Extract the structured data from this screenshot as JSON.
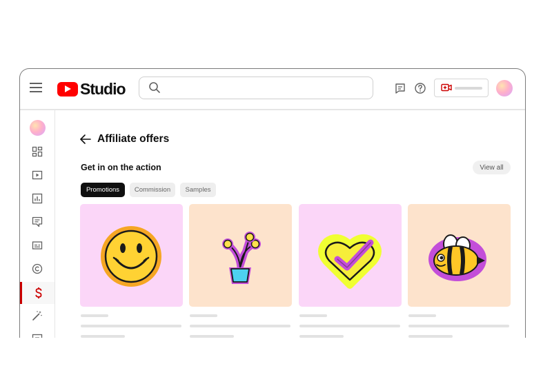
{
  "app": {
    "name": "Studio",
    "search_placeholder": ""
  },
  "page": {
    "title": "Affiliate offers",
    "section_title": "Get in on the action",
    "view_all_label": "View all"
  },
  "tabs": [
    {
      "label": "Promotions",
      "active": true
    },
    {
      "label": "Commission",
      "active": false
    },
    {
      "label": "Samples",
      "active": false
    }
  ],
  "sidebar": {
    "items": [
      {
        "icon": "dashboard-icon"
      },
      {
        "icon": "content-icon"
      },
      {
        "icon": "analytics-icon"
      },
      {
        "icon": "comments-icon"
      },
      {
        "icon": "subtitles-icon"
      },
      {
        "icon": "copyright-icon"
      },
      {
        "icon": "earn-icon",
        "active": true
      },
      {
        "icon": "customization-icon"
      }
    ]
  },
  "cards": [
    {
      "image": "smiley-face-sticker",
      "background": "#fbd6f8"
    },
    {
      "image": "flower-pot-sticker",
      "background": "#fde3cc"
    },
    {
      "image": "heart-check-sticker",
      "background": "#fbd6f8"
    },
    {
      "image": "bee-sticker",
      "background": "#fde3cc"
    }
  ],
  "colors": {
    "brand_red": "#ff0000",
    "active_red": "#cc0000",
    "chip_active": "#0f0f0f"
  }
}
